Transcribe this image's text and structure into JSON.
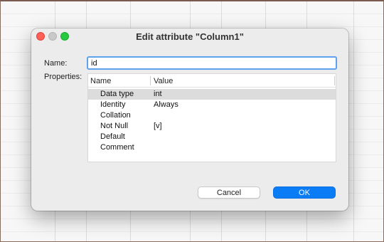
{
  "dialog": {
    "title": "Edit attribute \"Column1\"",
    "name_label": "Name:",
    "name_value": "id",
    "properties_label": "Properties:"
  },
  "table": {
    "headers": {
      "name": "Name",
      "value": "Value"
    },
    "rows": [
      {
        "name": "Data type",
        "value": "int",
        "selected": true
      },
      {
        "name": "Identity",
        "value": "Always"
      },
      {
        "name": "Collation",
        "value": ""
      },
      {
        "name": "Not Null",
        "value": "[v]"
      },
      {
        "name": "Default",
        "value": ""
      },
      {
        "name": "Comment",
        "value": ""
      }
    ]
  },
  "buttons": {
    "cancel": "Cancel",
    "ok": "OK"
  },
  "colors": {
    "accent": "#0a7cf5",
    "focus_ring": "#5ea2ee",
    "close": "#fe5f57",
    "zoom": "#28c840"
  }
}
